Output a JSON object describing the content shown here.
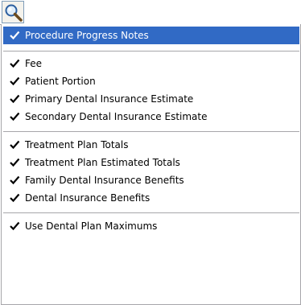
{
  "toolbar": {
    "zoom_icon": "magnifier-icon"
  },
  "menu": {
    "check_icon": "checkmark-icon",
    "colors": {
      "highlight": "#316ac5",
      "highlight_text": "#ffffff"
    },
    "groups": [
      [
        {
          "label": "Procedure Progress Notes",
          "checked": true,
          "selected": true
        }
      ],
      [
        {
          "label": "Fee",
          "checked": true
        },
        {
          "label": "Patient Portion",
          "checked": true
        },
        {
          "label": "Primary Dental Insurance Estimate",
          "checked": true
        },
        {
          "label": "Secondary Dental Insurance Estimate",
          "checked": true
        }
      ],
      [
        {
          "label": "Treatment Plan Totals",
          "checked": true
        },
        {
          "label": "Treatment Plan Estimated Totals",
          "checked": true
        },
        {
          "label": "Family Dental Insurance Benefits",
          "checked": true
        },
        {
          "label": "Dental Insurance Benefits",
          "checked": true
        }
      ],
      [
        {
          "label": "Use Dental Plan Maximums",
          "checked": true
        }
      ]
    ]
  }
}
